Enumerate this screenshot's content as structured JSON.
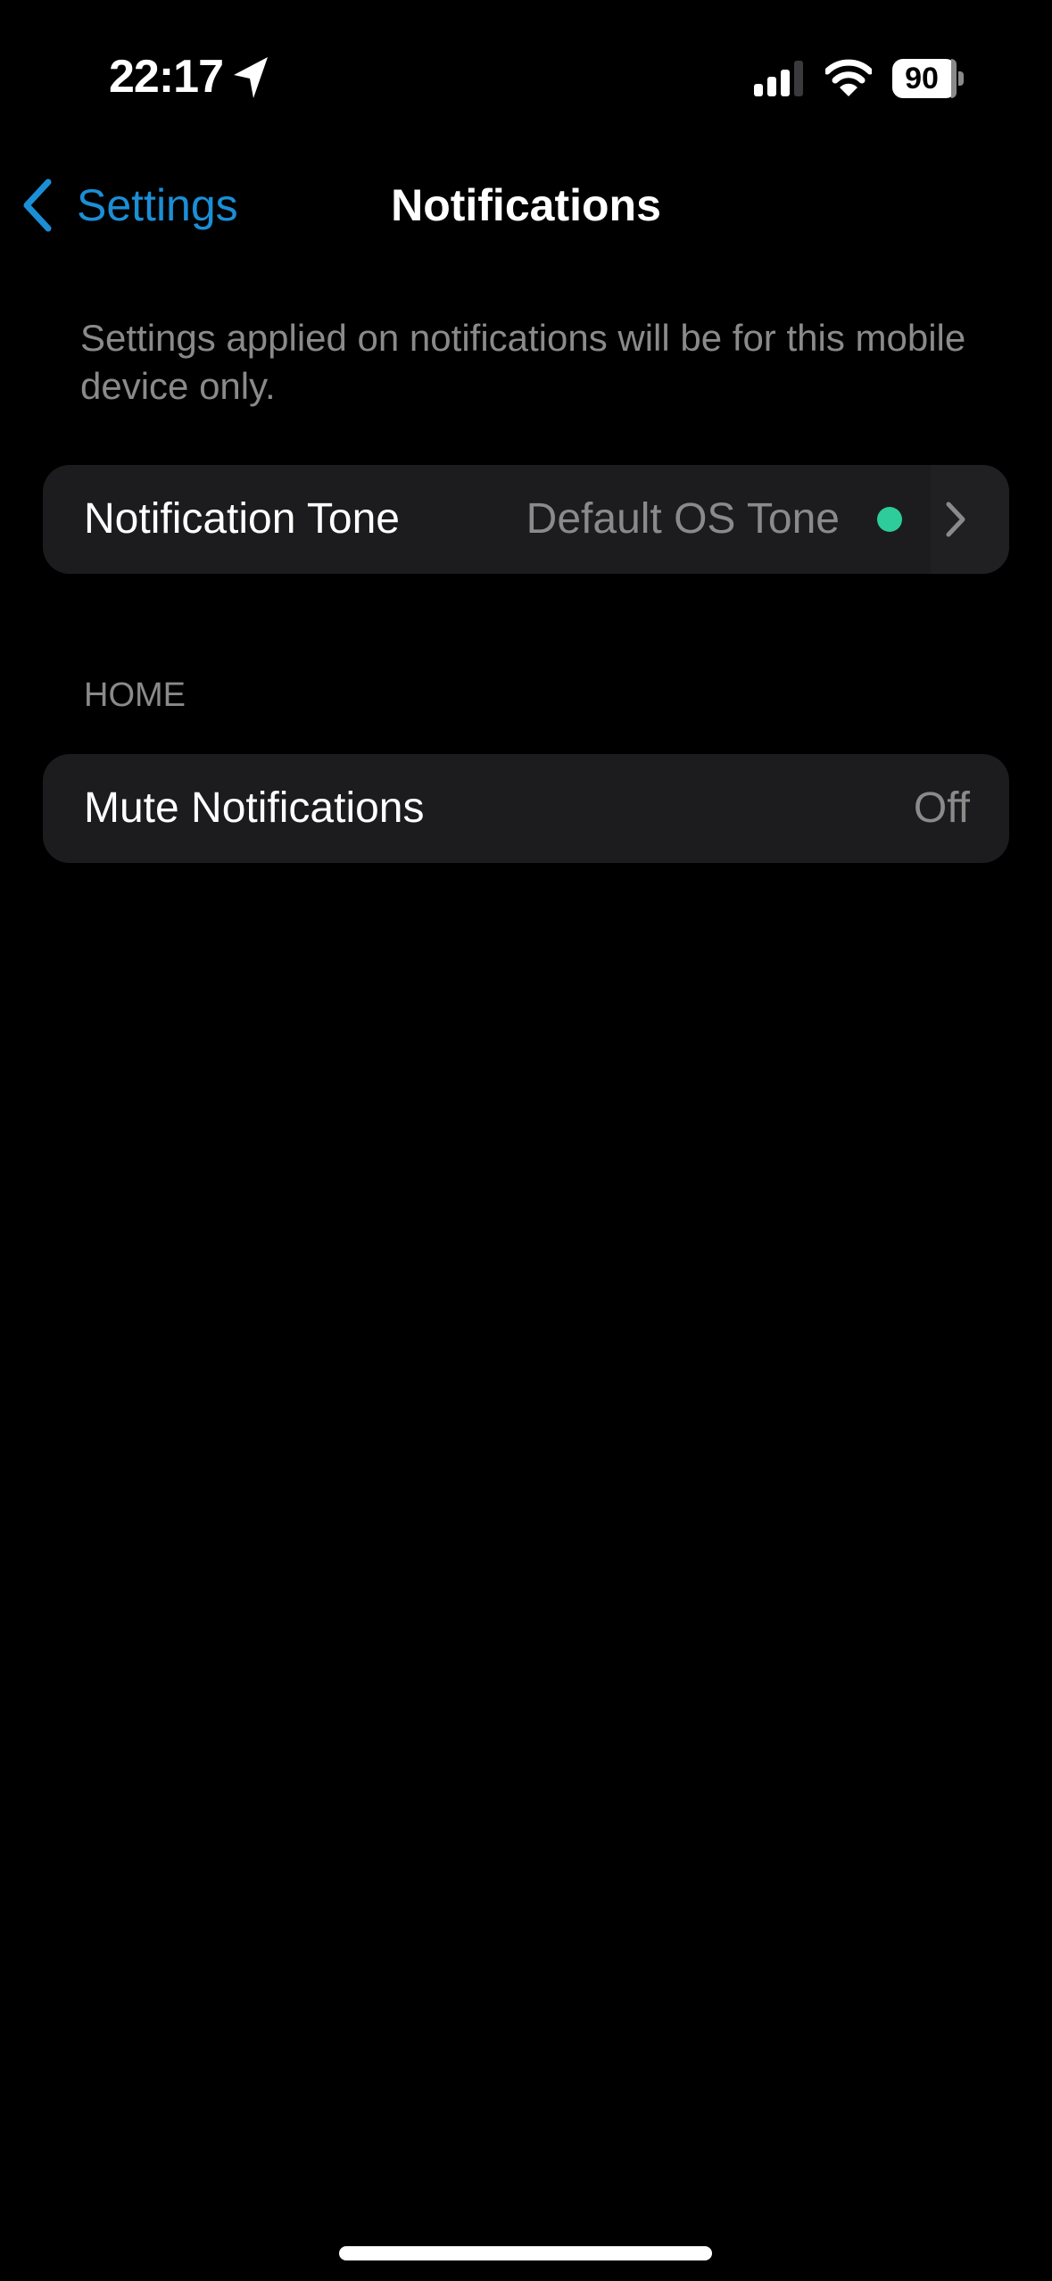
{
  "status_bar": {
    "time": "22:17",
    "location_icon": "location-arrow-icon",
    "signal_icon": "cellular-signal-icon",
    "signal_bars_active": 3,
    "signal_bars_total": 4,
    "wifi_icon": "wifi-icon",
    "battery_icon": "battery-icon",
    "battery_level": "90"
  },
  "nav": {
    "back_icon": "chevron-left-icon",
    "back_label": "Settings",
    "title": "Notifications"
  },
  "description": "Settings applied on notifications will be for this mobile device only.",
  "rows": {
    "notification_tone": {
      "label": "Notification Tone",
      "value": "Default OS Tone",
      "status_dot_color": "#2dcc9a",
      "chevron_icon": "chevron-right-icon"
    }
  },
  "sections": {
    "home": {
      "header": "HOME",
      "mute_notifications": {
        "label": "Mute Notifications",
        "value": "Off"
      }
    }
  },
  "colors": {
    "accent": "#1b8fd6",
    "background": "#000000",
    "card": "#1c1c1e",
    "secondary_text": "#8a8a8a"
  }
}
